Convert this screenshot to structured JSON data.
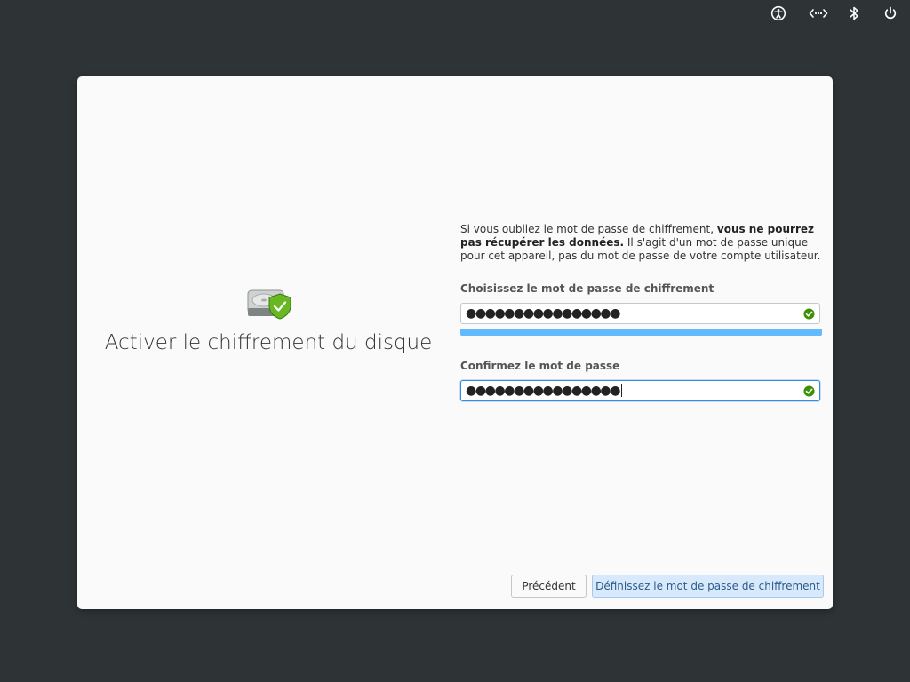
{
  "top_panel": {
    "icons": [
      "accessibility-icon",
      "network-icon",
      "bluetooth-icon",
      "power-icon"
    ]
  },
  "page": {
    "title": "Activer le chiffrement du disque",
    "info_part1": "Si vous oubliez le mot de passe de chiffrement, ",
    "info_bold": "vous ne pourrez pas récupérer les données.",
    "info_part2": " Il s'agit d'un mot de passe unique pour cet appareil, pas du mot de passe de votre compte utilisateur."
  },
  "password": {
    "label": "Choisissez le mot de passe de chiffrement",
    "masked_value": "●●●●●●●●●●●●●●●●",
    "strength": 1.0
  },
  "confirm": {
    "label": "Confirmez le mot de passe",
    "masked_value": "●●●●●●●●●●●●●●●●"
  },
  "buttons": {
    "previous": "Précédent",
    "set_password": "Définissez le mot de passe de chiffrement"
  },
  "colors": {
    "background": "#2e3436",
    "accent": "#3689e6",
    "success": "#3a9104",
    "strength_fill": "#64baff"
  }
}
